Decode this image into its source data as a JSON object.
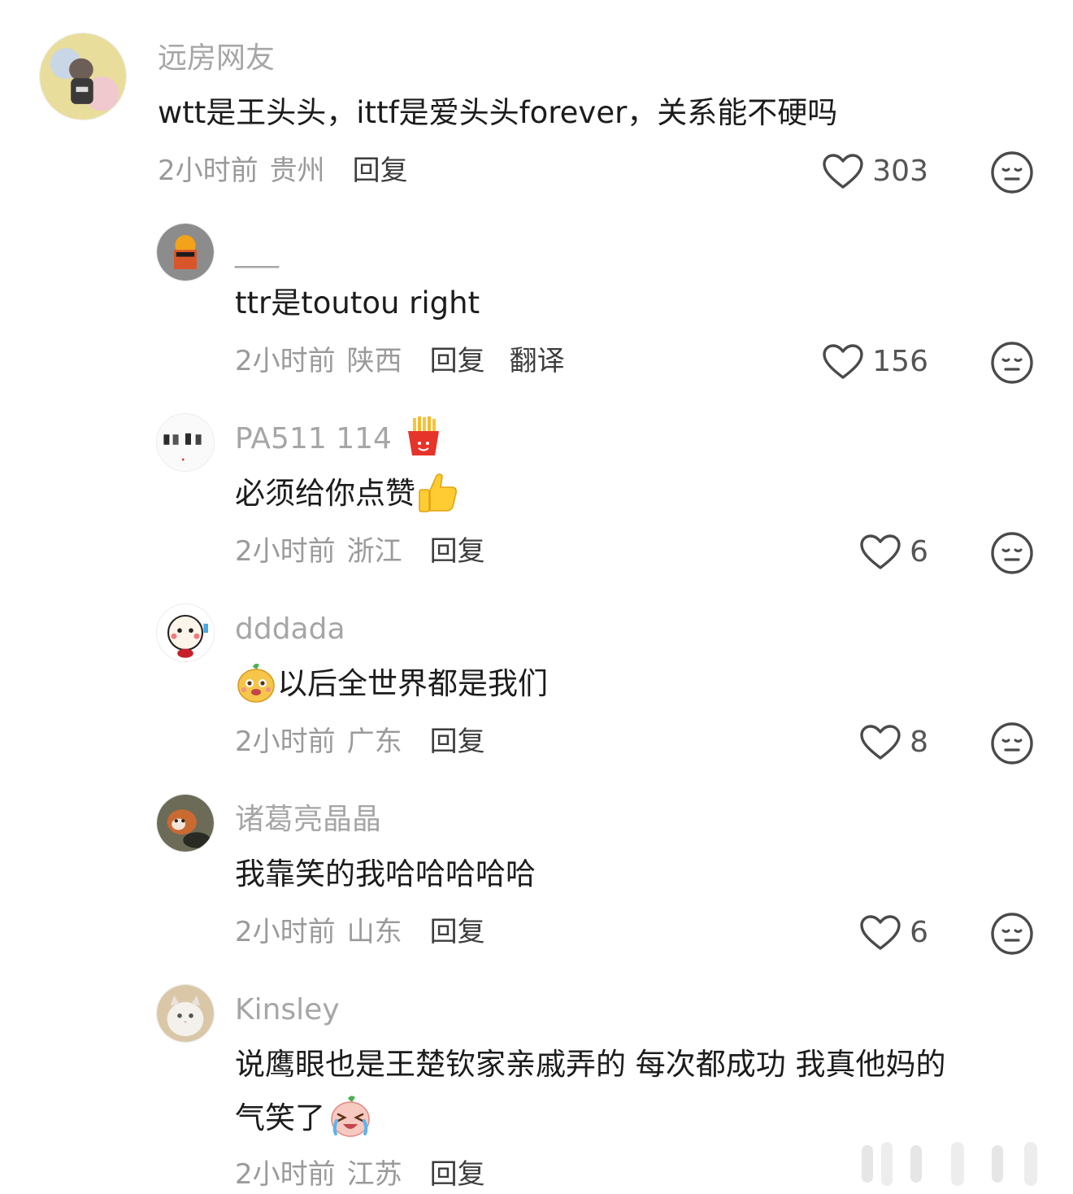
{
  "comments": [
    {
      "username": "远房网友",
      "text": "wtt是王头头，ittf是爱头头forever，关系能不硬吗",
      "time": "2小时前",
      "location": "贵州",
      "reply_label": "回复",
      "likes": "303"
    },
    {
      "username": "___",
      "text": "ttr是toutou right",
      "time": "2小时前",
      "location": "陕西",
      "reply_label": "回复",
      "translate_label": "翻译",
      "likes": "156"
    },
    {
      "username": "PA511 114",
      "text": "必须给你点赞",
      "time": "2小时前",
      "location": "浙江",
      "reply_label": "回复",
      "likes": "6"
    },
    {
      "username": "dddada",
      "text": "以后全世界都是我们",
      "time": "2小时前",
      "location": "广东",
      "reply_label": "回复",
      "likes": "8"
    },
    {
      "username": "诸葛亮晶晶",
      "text": "我靠笑的我哈哈哈哈哈",
      "time": "2小时前",
      "location": "山东",
      "reply_label": "回复",
      "likes": "6"
    },
    {
      "username": "Kinsley",
      "text_line1": "说鹰眼也是王楚钦家亲戚弄的 每次都成功 我真他妈的",
      "text_line2": "气笑了",
      "time": "2小时前",
      "location": "江苏",
      "reply_label": "回复"
    }
  ],
  "colors": {
    "username": "#a6a6a6",
    "text": "#1c1c1c",
    "meta": "#9a9a9a",
    "reply": "#3d3d3d",
    "icon": "#4a4a4a"
  },
  "icons": [
    "heart-outline-icon",
    "dislike-face-icon",
    "fries-emoji",
    "thumbs-up-emoji",
    "smiling-face-emoji",
    "laugh-cry-emoji"
  ]
}
